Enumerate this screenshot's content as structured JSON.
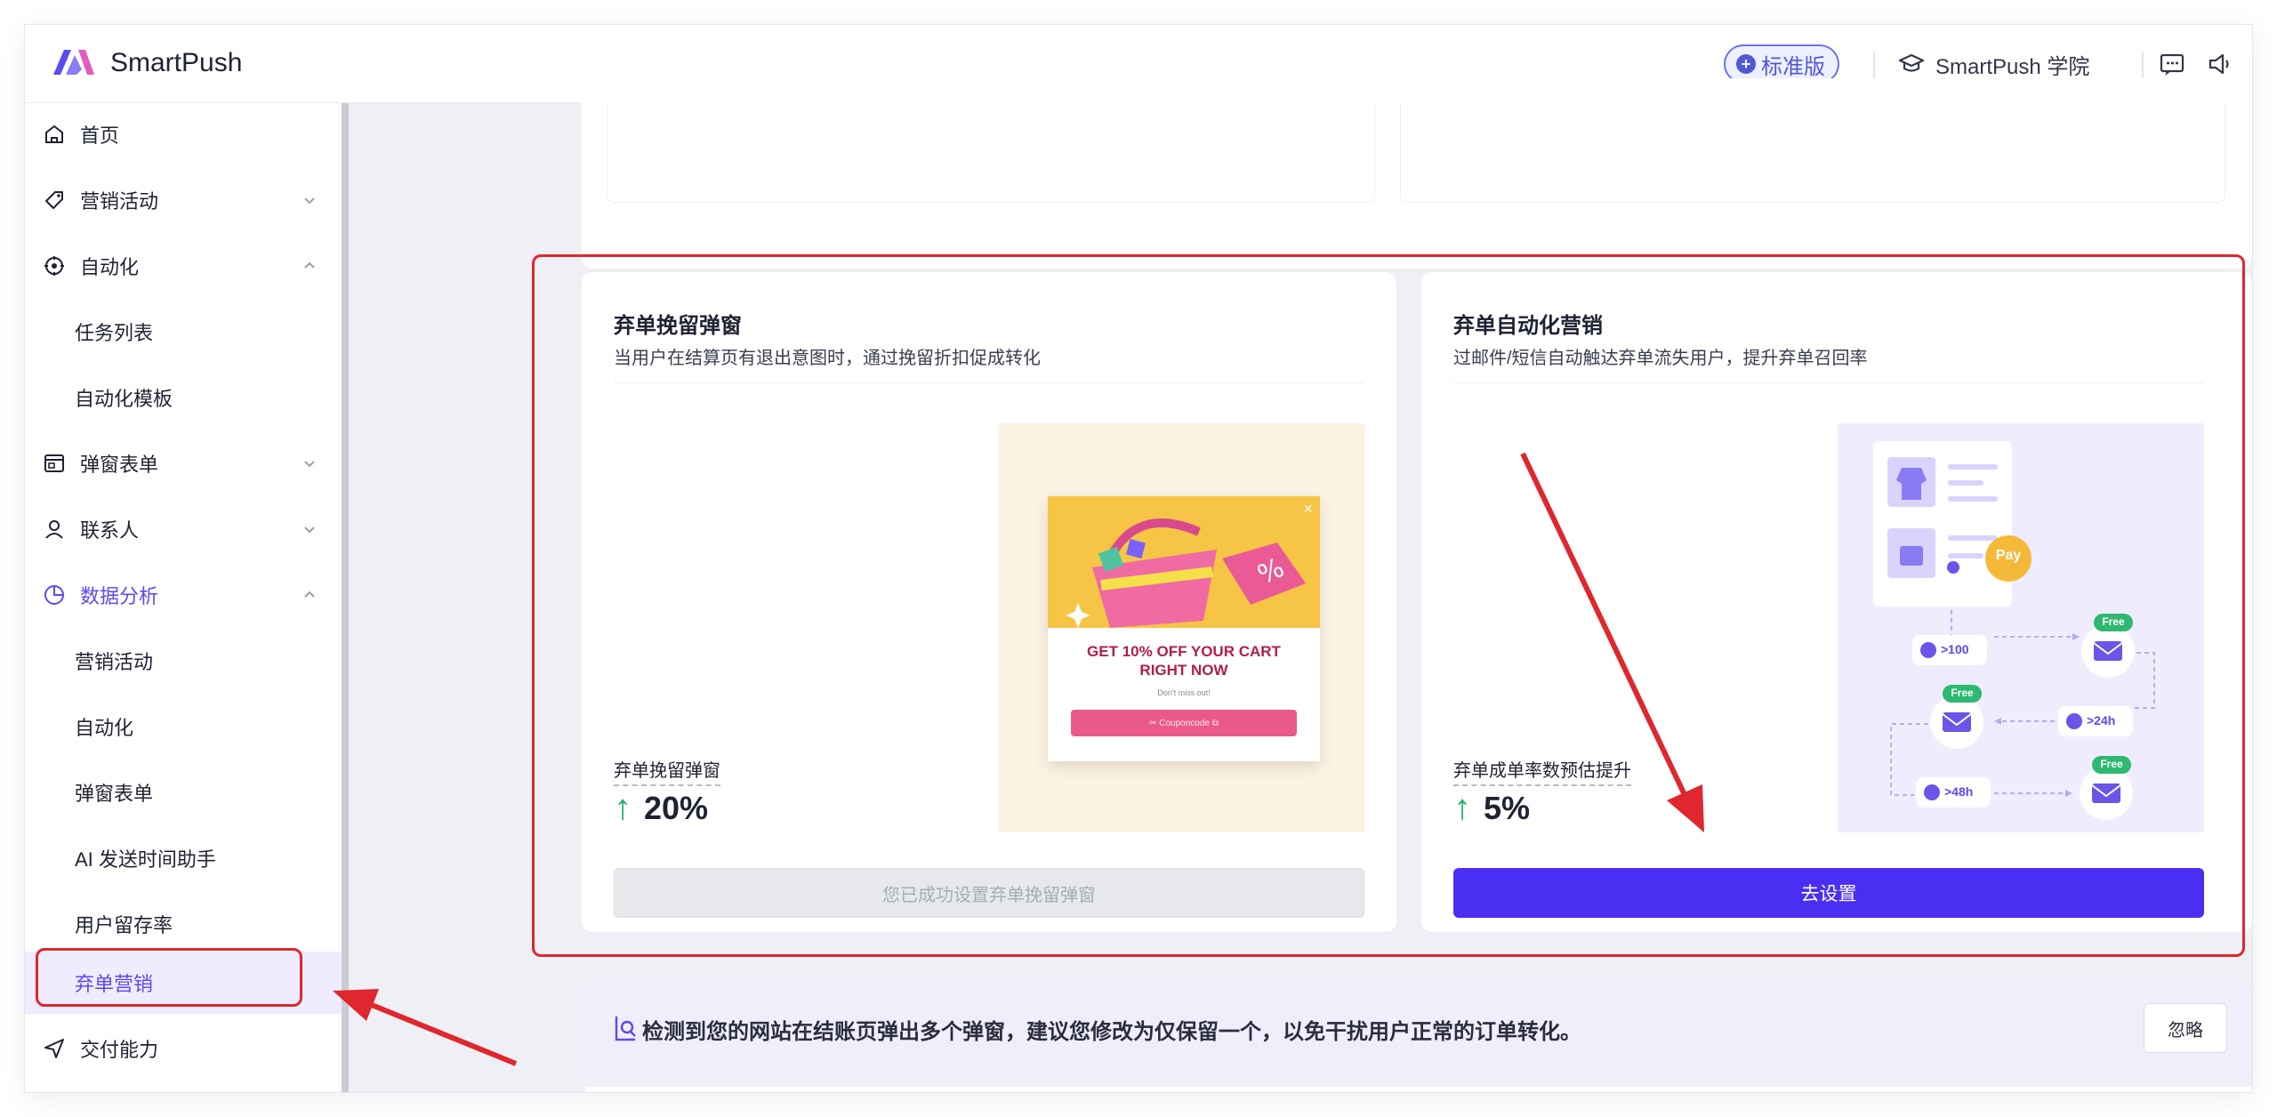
{
  "header": {
    "brand": "SmartPush",
    "plan_badge": "标准版",
    "academy_label": "SmartPush 学院",
    "colors": {
      "accent": "#5a4af1",
      "brand_blue": "#4f59d8"
    }
  },
  "sidebar": {
    "items": [
      {
        "label": "首页",
        "icon": "home-icon"
      },
      {
        "label": "营销活动",
        "icon": "tag-icon",
        "chevron": "down"
      },
      {
        "label": "自动化",
        "icon": "automation-icon",
        "chevron": "up"
      },
      {
        "label": "任务列表",
        "sub": true
      },
      {
        "label": "自动化模板",
        "sub": true
      },
      {
        "label": "弹窗表单",
        "icon": "popup-form-icon",
        "chevron": "down"
      },
      {
        "label": "联系人",
        "icon": "contact-icon",
        "chevron": "down"
      },
      {
        "label": "数据分析",
        "icon": "analytics-icon",
        "chevron": "up",
        "active": true
      },
      {
        "label": "营销活动",
        "sub": true
      },
      {
        "label": "自动化",
        "sub": true
      },
      {
        "label": "弹窗表单",
        "sub": true
      },
      {
        "label": "AI 发送时间助手",
        "sub": true
      },
      {
        "label": "用户留存率",
        "sub": true
      },
      {
        "label": "弃单营销",
        "sub": true,
        "selected": true
      },
      {
        "label": "交付能力",
        "icon": "send-icon"
      }
    ]
  },
  "cards": {
    "retention": {
      "title": "弃单挽留弹窗",
      "description": "当用户在结算页有退出意图时，通过挽留折扣促成转化",
      "metric_label": "弃单挽留弹窗",
      "metric_value": "20%",
      "button_label": "您已成功设置弃单挽留弹窗",
      "preview": {
        "headline_1": "GET 10% OFF YOUR CART",
        "headline_2": "RIGHT NOW",
        "subline": "Don't miss out!",
        "coupon": "✂ Couponcode ⧉"
      }
    },
    "automation": {
      "title": "弃单自动化营销",
      "description": "过邮件/短信自动触达弃单流失用户，提升弃单召回率",
      "metric_label": "弃单成单率数预估提升",
      "metric_value": "5%",
      "button_label": "去设置",
      "flow": {
        "pay": "Pay",
        "amount": ">100",
        "wait_24": ">24h",
        "wait_48": ">48h",
        "free": "Free"
      }
    }
  },
  "notice": {
    "text": "检测到您的网站在结账页弹出多个弹窗，建议您修改为仅保留一个，以免干扰用户正常的订单转化。",
    "ignore_label": "忽略"
  }
}
